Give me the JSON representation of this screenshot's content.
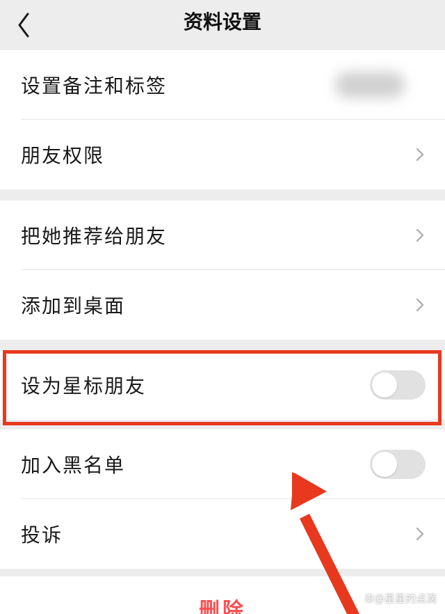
{
  "header": {
    "title": "资料设置",
    "back_icon": "chevron-left-icon"
  },
  "groups": [
    {
      "items": [
        {
          "label": "设置备注和标签",
          "value_blurred": true
        },
        {
          "label": "朋友权限",
          "accessory": "chevron-right-icon"
        }
      ]
    },
    {
      "items": [
        {
          "label": "把她推荐给朋友",
          "accessory": "chevron-right-icon"
        },
        {
          "label": "添加到桌面",
          "accessory": "chevron-right-icon"
        }
      ]
    },
    {
      "items": [
        {
          "label": "设为星标朋友",
          "toggle": false,
          "highlighted": true
        }
      ]
    },
    {
      "items": [
        {
          "label": "加入黑名单",
          "toggle": false
        },
        {
          "label": "投诉",
          "accessory": "chevron-right-icon"
        }
      ]
    }
  ],
  "delete": {
    "label": "删除"
  },
  "annotation": {
    "highlight_color": "#e8381e",
    "arrow_color": "#e8381e"
  },
  "watermark": {
    "text": "ꕥ@星星的点滴"
  },
  "colors": {
    "page_background": "#ededed",
    "cell_background": "#ffffff",
    "delete_text": "#fa5151",
    "toggle_off": "#e1e1e1"
  }
}
